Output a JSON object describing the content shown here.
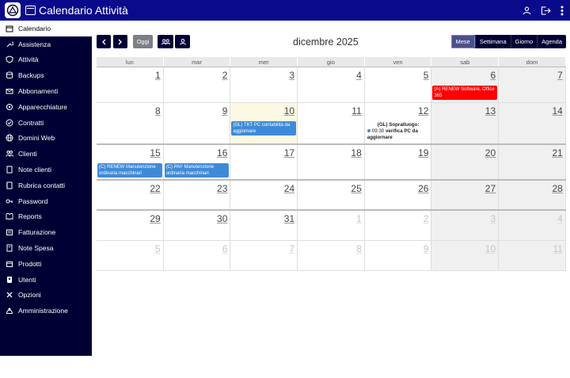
{
  "app": {
    "title": "Calendario Attività"
  },
  "sidebar": {
    "items": [
      {
        "label": "Calendario",
        "icon": "calendar-icon",
        "active": true
      },
      {
        "label": "Assistenza",
        "icon": "wrench-icon"
      },
      {
        "label": "Attività",
        "icon": "shield-icon"
      },
      {
        "label": "Backups",
        "icon": "database-icon"
      },
      {
        "label": "Abbonamenti",
        "icon": "envelope-icon"
      },
      {
        "label": "Apparecchiature",
        "icon": "gear-icon"
      },
      {
        "label": "Contratti",
        "icon": "check-circle-icon"
      },
      {
        "label": "Domini Web",
        "icon": "globe-icon"
      },
      {
        "label": "Clienti",
        "icon": "users-icon"
      },
      {
        "label": "Note clienti",
        "icon": "note-icon"
      },
      {
        "label": "Rubrica contatti",
        "icon": "address-book-icon"
      },
      {
        "label": "Password",
        "icon": "key-icon"
      },
      {
        "label": "Reports",
        "icon": "book-icon"
      },
      {
        "label": "Fatturazione",
        "icon": "invoice-icon"
      },
      {
        "label": "Note Spesa",
        "icon": "receipt-icon"
      },
      {
        "label": "Prodotti",
        "icon": "box-icon"
      },
      {
        "label": "Utenti",
        "icon": "user-badge-icon"
      },
      {
        "label": "Opzioni",
        "icon": "tools-icon"
      },
      {
        "label": "Amministrazione",
        "icon": "admin-icon"
      }
    ]
  },
  "toolbar": {
    "today_label": "Oggi",
    "month_title": "dicembre 2025",
    "views": [
      {
        "label": "Mese",
        "active": true
      },
      {
        "label": "Settimana"
      },
      {
        "label": "Giorno"
      },
      {
        "label": "Agenda"
      }
    ]
  },
  "calendar": {
    "weekdays": [
      "lun",
      "mar",
      "mer",
      "gio",
      "ven",
      "sab",
      "dom"
    ],
    "weeks": [
      [
        "1",
        "2",
        "3",
        "4",
        "5",
        "6",
        "7"
      ],
      [
        "8",
        "9",
        "10",
        "11",
        "12",
        "13",
        "14"
      ],
      [
        "15",
        "16",
        "17",
        "18",
        "19",
        "20",
        "21"
      ],
      [
        "22",
        "23",
        "24",
        "25",
        "26",
        "27",
        "28"
      ],
      [
        "29",
        "30",
        "31",
        "1",
        "2",
        "3",
        "4"
      ],
      [
        "5",
        "6",
        "7",
        "8",
        "9",
        "10",
        "11"
      ]
    ],
    "events": {
      "red_6": "(A) RENEW Software, Office 365",
      "blue_10": "(GL) TKT PC contabilità da aggiornare",
      "dot_12_title": "(GL) Sopralluogo:",
      "dot_12_time": "09:30",
      "dot_12_text": "verifica PC da aggiornare",
      "blue_15": "(C) RENEW Manutenzione ordinaria macchinari",
      "blue_16": "(C) PAY Manutenzione ordinaria macchinari"
    }
  },
  "colors": {
    "topbar": "#0a0a8c",
    "sidebar": "#000034",
    "event_blue": "#3f8ad8",
    "event_red": "#ff0000",
    "today_bg": "#fcf8e3"
  }
}
